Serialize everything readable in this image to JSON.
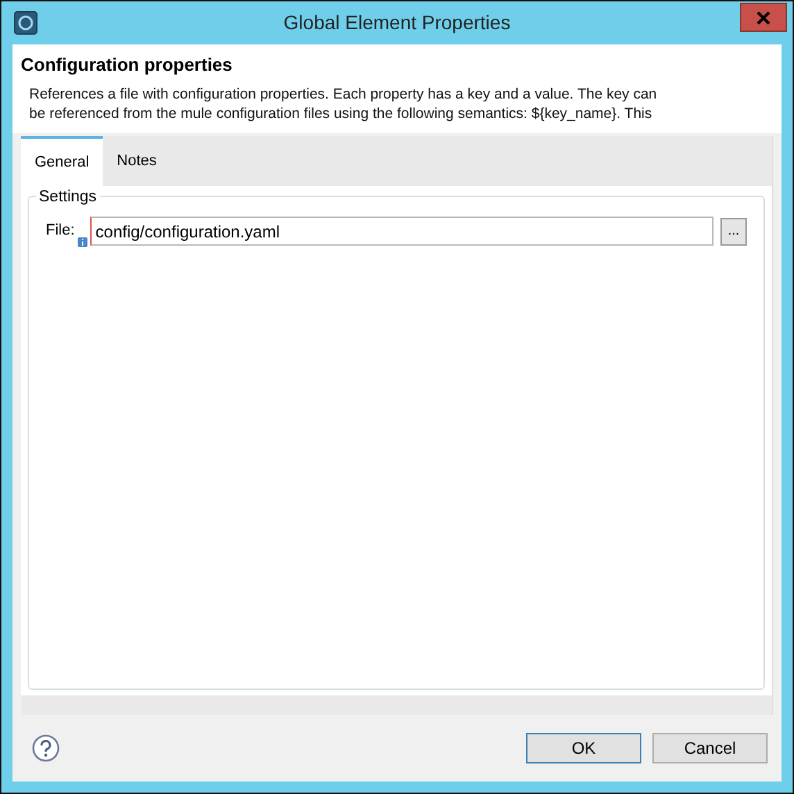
{
  "window": {
    "title": "Global Element Properties"
  },
  "header": {
    "title": "Configuration properties",
    "description_lines": [
      "References a file with configuration properties. Each property has a key and a value. The key can",
      "be referenced from the mule configuration files using the following semantics: ${key_name}. This"
    ]
  },
  "tabs": [
    {
      "label": "General",
      "selected": true
    },
    {
      "label": "Notes",
      "selected": false
    }
  ],
  "settings": {
    "legend": "Settings",
    "file_label": "File:",
    "file_value": "config/configuration.yaml",
    "browse_button": "..."
  },
  "buttons": [
    {
      "label": "OK",
      "default": true
    },
    {
      "label": "Cancel",
      "default": false
    }
  ]
}
